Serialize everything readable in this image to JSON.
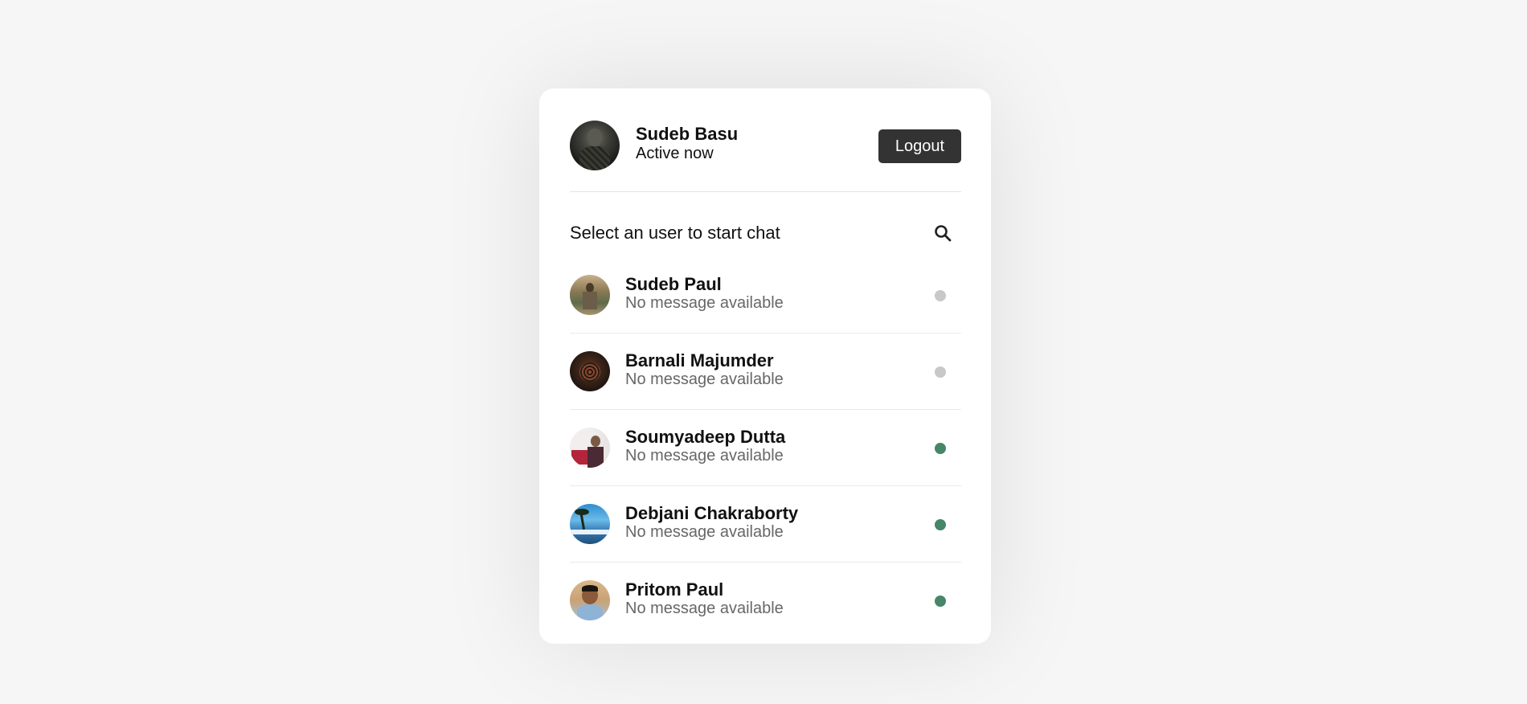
{
  "current_user": {
    "name": "Sudeb Basu",
    "status": "Active now",
    "avatar_icon": "user-photo"
  },
  "header": {
    "logout_label": "Logout"
  },
  "search": {
    "prompt": "Select an user to start chat",
    "icon": "search-icon"
  },
  "colors": {
    "online": "#468669",
    "offline": "#c8c8c8",
    "logout_bg": "#333333"
  },
  "users": [
    {
      "name": "Sudeb Paul",
      "message": "No message available",
      "status": "offline"
    },
    {
      "name": "Barnali Majumder",
      "message": "No message available",
      "status": "offline"
    },
    {
      "name": "Soumyadeep Dutta",
      "message": "No message available",
      "status": "online"
    },
    {
      "name": "Debjani Chakraborty",
      "message": "No message available",
      "status": "online"
    },
    {
      "name": "Pritom Paul",
      "message": "No message available",
      "status": "online"
    }
  ]
}
